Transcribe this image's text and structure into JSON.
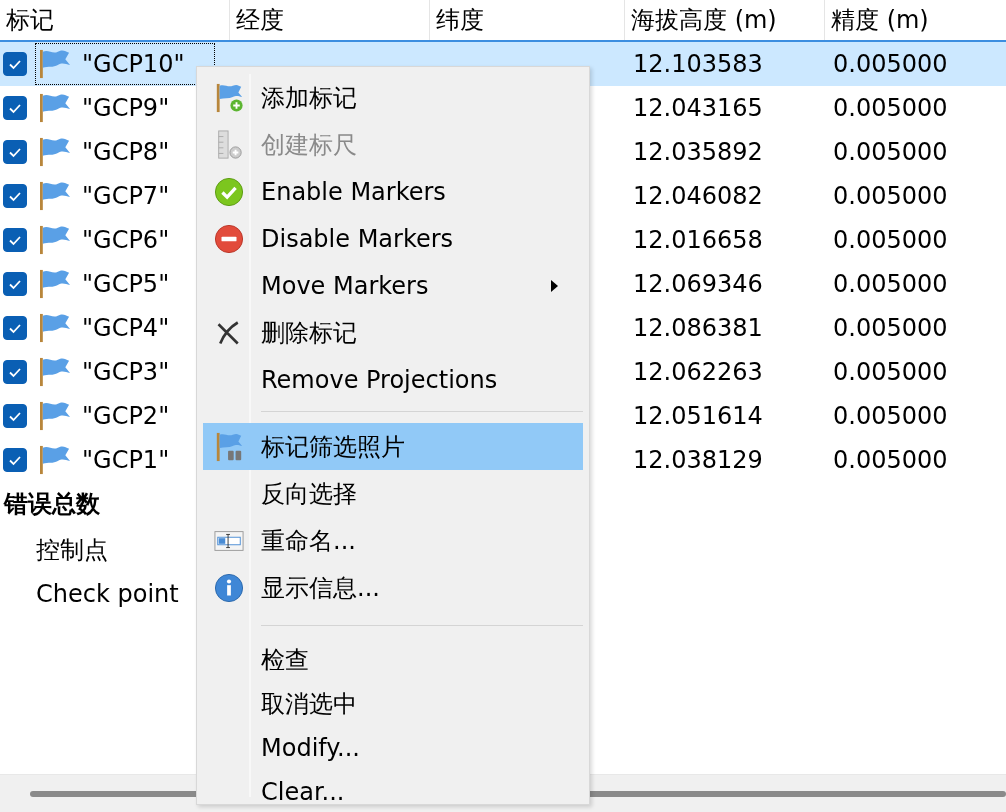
{
  "table": {
    "columns": [
      "标记",
      "经度",
      "纬度",
      "海拔高度 (m)",
      "精度 (m)"
    ],
    "rows": [
      {
        "checked": true,
        "selected": true,
        "name": "\"GCP10\"",
        "altitude": "12.103583",
        "accuracy": "0.005000"
      },
      {
        "checked": true,
        "selected": false,
        "name": "\"GCP9\"",
        "altitude": "12.043165",
        "accuracy": "0.005000"
      },
      {
        "checked": true,
        "selected": false,
        "name": "\"GCP8\"",
        "altitude": "12.035892",
        "accuracy": "0.005000"
      },
      {
        "checked": true,
        "selected": false,
        "name": "\"GCP7\"",
        "altitude": "12.046082",
        "accuracy": "0.005000"
      },
      {
        "checked": true,
        "selected": false,
        "name": "\"GCP6\"",
        "altitude": "12.016658",
        "accuracy": "0.005000"
      },
      {
        "checked": true,
        "selected": false,
        "name": "\"GCP5\"",
        "altitude": "12.069346",
        "accuracy": "0.005000"
      },
      {
        "checked": true,
        "selected": false,
        "name": "\"GCP4\"",
        "altitude": "12.086381",
        "accuracy": "0.005000"
      },
      {
        "checked": true,
        "selected": false,
        "name": "\"GCP3\"",
        "altitude": "12.062263",
        "accuracy": "0.005000"
      },
      {
        "checked": true,
        "selected": false,
        "name": "\"GCP2\"",
        "altitude": "12.051614",
        "accuracy": "0.005000"
      },
      {
        "checked": true,
        "selected": false,
        "name": "\"GCP1\"",
        "altitude": "12.038129",
        "accuracy": "0.005000"
      }
    ]
  },
  "summary": {
    "title": "错误总数",
    "children": [
      "控制点",
      "Check point"
    ]
  },
  "context_menu": {
    "groups": [
      [
        {
          "label": "添加标记",
          "disabled": false,
          "selected": false,
          "submenu": false
        },
        {
          "label": "创建标尺",
          "disabled": true,
          "selected": false,
          "submenu": false
        },
        {
          "label": "Enable Markers",
          "disabled": false,
          "selected": false,
          "submenu": false
        },
        {
          "label": "Disable Markers",
          "disabled": false,
          "selected": false,
          "submenu": false
        },
        {
          "label": "Move Markers",
          "disabled": false,
          "selected": false,
          "submenu": true
        },
        {
          "label": "删除标记",
          "disabled": false,
          "selected": false,
          "submenu": false
        },
        {
          "label": "Remove Projections",
          "disabled": false,
          "selected": false,
          "submenu": false
        }
      ],
      [
        {
          "label": "标记筛选照片",
          "disabled": false,
          "selected": true,
          "submenu": false
        },
        {
          "label": "反向选择",
          "disabled": false,
          "selected": false,
          "submenu": false
        },
        {
          "label": "重命名...",
          "disabled": false,
          "selected": false,
          "submenu": false
        },
        {
          "label": "显示信息...",
          "disabled": false,
          "selected": false,
          "submenu": false
        }
      ],
      [
        {
          "label": "检查",
          "disabled": false,
          "selected": false,
          "submenu": false
        },
        {
          "label": "取消选中",
          "disabled": false,
          "selected": false,
          "submenu": false
        },
        {
          "label": "Modify...",
          "disabled": false,
          "selected": false,
          "submenu": false
        },
        {
          "label": "Clear...",
          "disabled": false,
          "selected": false,
          "submenu": false
        }
      ]
    ]
  }
}
